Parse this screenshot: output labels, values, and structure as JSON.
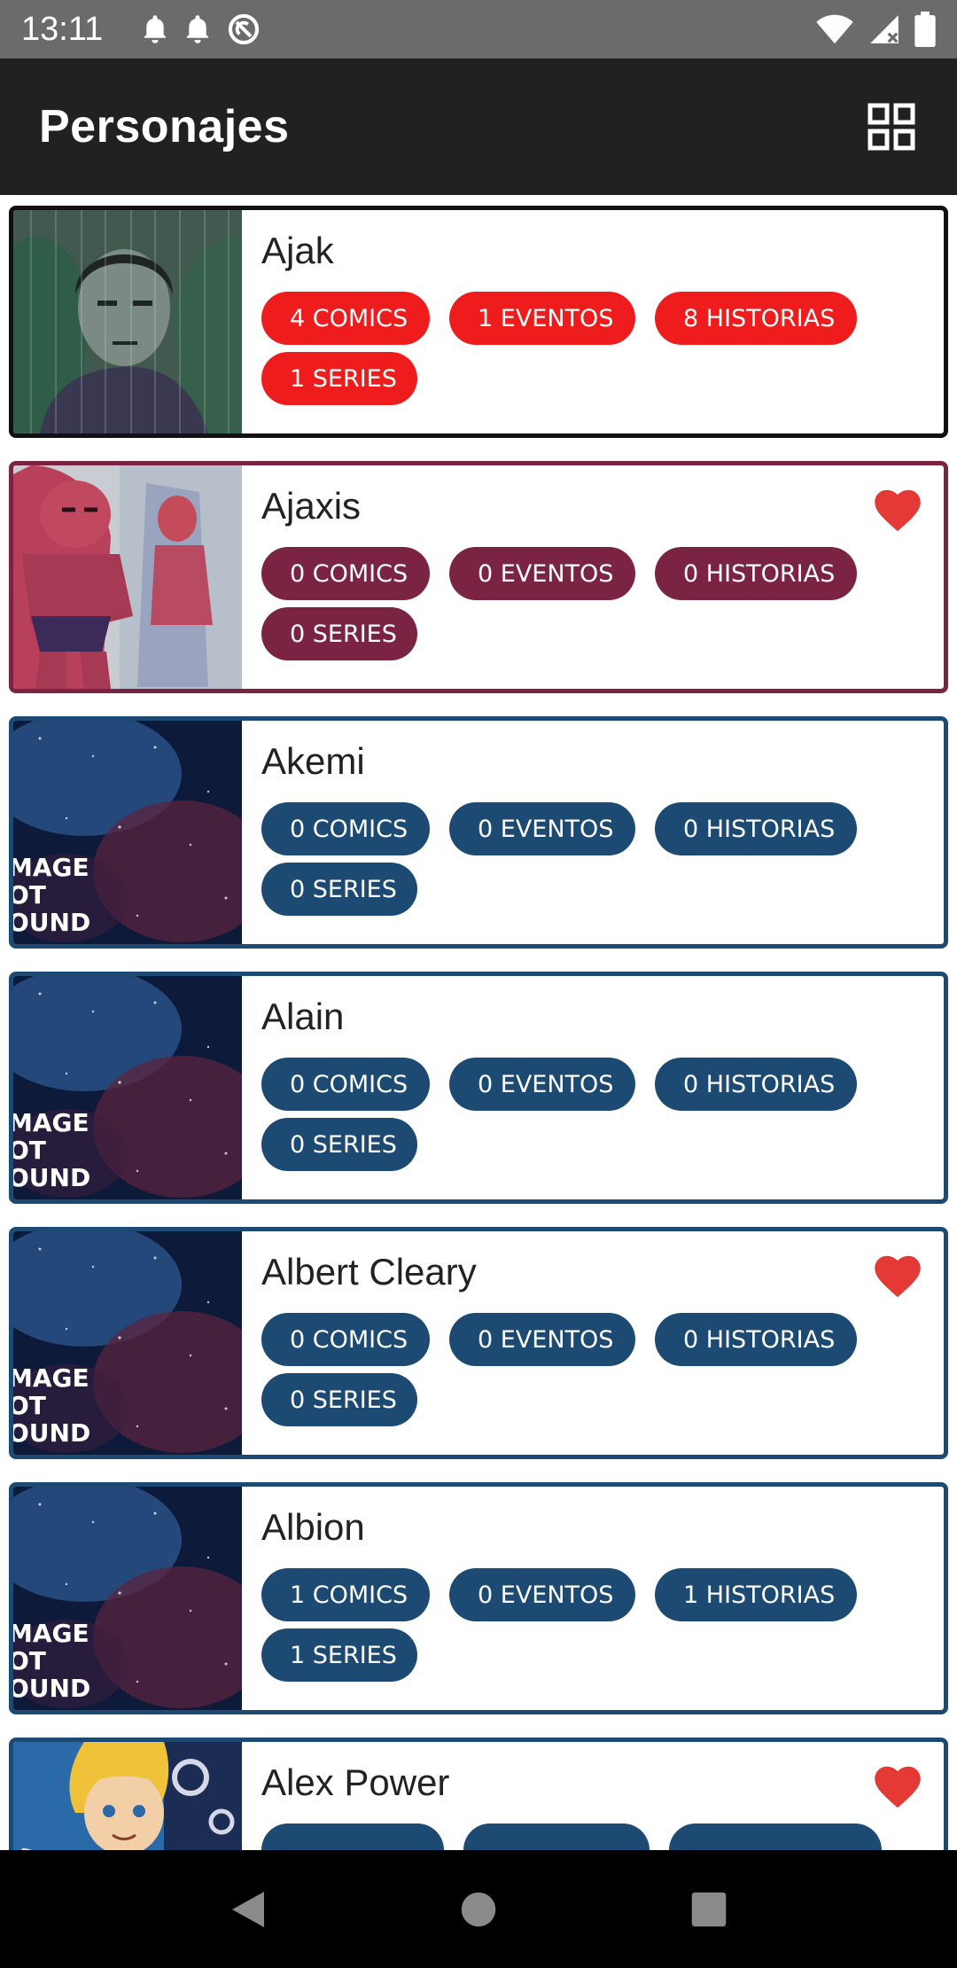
{
  "status": {
    "time": "13:11",
    "icons": [
      "bell-icon",
      "bell-icon",
      "sync-off-icon",
      "wifi-icon",
      "signal-icon",
      "battery-icon"
    ]
  },
  "app_bar": {
    "title": "Personajes",
    "grid_icon": "grid-view-icon"
  },
  "colors": {
    "status_bar": "#6b6b6b",
    "app_bar": "#212121",
    "chip_red": "#ee1c1c",
    "chip_wine": "#7b2342",
    "chip_blue": "#1d4a72",
    "heart": "#e53935"
  },
  "characters": [
    {
      "name": "Ajak",
      "favorite": false,
      "comics": "4 COMICS",
      "eventos": "1 EVENTOS",
      "historias": "8 HISTORIAS",
      "series": "1 SERIES"
    },
    {
      "name": "Ajaxis",
      "favorite": true,
      "comics": "0 COMICS",
      "eventos": "0 EVENTOS",
      "historias": "0 HISTORIAS",
      "series": "0 SERIES"
    },
    {
      "name": "Akemi",
      "favorite": false,
      "comics": "0 COMICS",
      "eventos": "0 EVENTOS",
      "historias": "0 HISTORIAS",
      "series": "0 SERIES",
      "thumb_text": [
        "MAGE",
        "OT",
        "OUND"
      ]
    },
    {
      "name": "Alain",
      "favorite": false,
      "comics": "0 COMICS",
      "eventos": "0 EVENTOS",
      "historias": "0 HISTORIAS",
      "series": "0 SERIES",
      "thumb_text": [
        "MAGE",
        "OT",
        "OUND"
      ]
    },
    {
      "name": "Albert Cleary",
      "favorite": true,
      "comics": "0 COMICS",
      "eventos": "0 EVENTOS",
      "historias": "0 HISTORIAS",
      "series": "0 SERIES",
      "thumb_text": [
        "MAGE",
        "OT",
        "OUND"
      ]
    },
    {
      "name": "Albion",
      "favorite": false,
      "comics": "1 COMICS",
      "eventos": "0 EVENTOS",
      "historias": "1 HISTORIAS",
      "series": "1 SERIES",
      "thumb_text": [
        "MAGE",
        "OT",
        "OUND"
      ]
    },
    {
      "name": "Alex Power",
      "favorite": true
    }
  ],
  "nav": {
    "back": "back-icon",
    "home": "home-icon",
    "recents": "recents-icon"
  }
}
